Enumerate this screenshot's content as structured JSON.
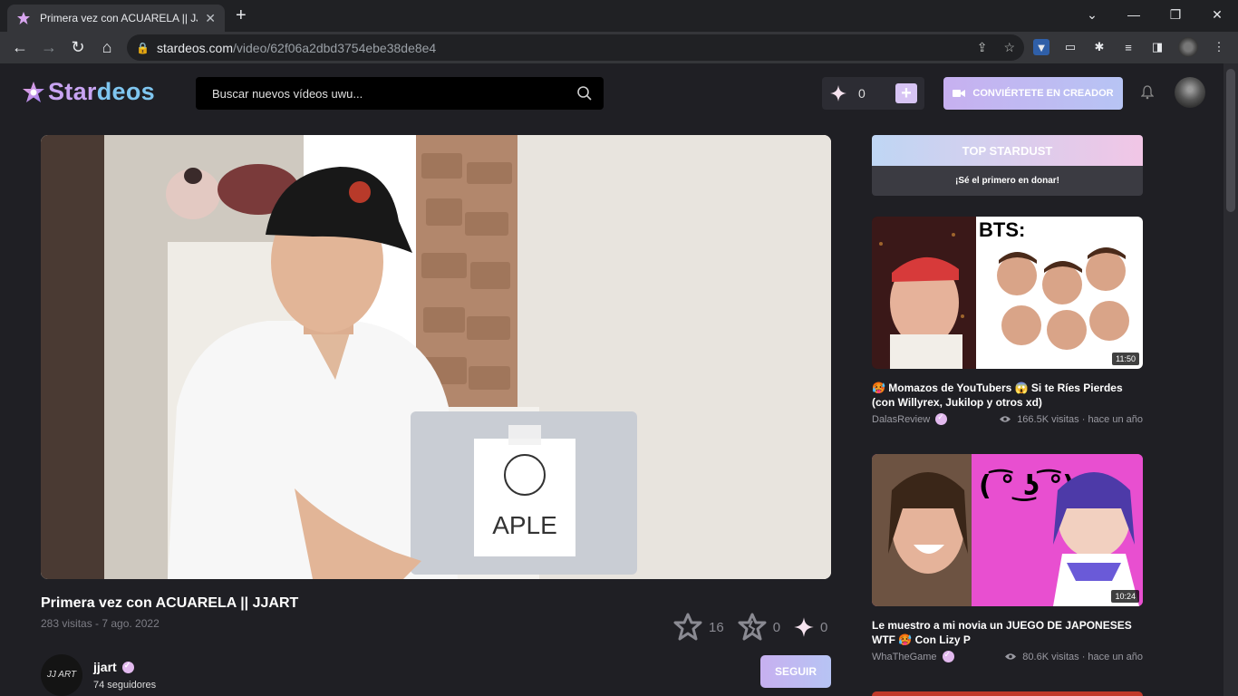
{
  "browser": {
    "tab_title": "Primera vez con ACUARELA || JJA",
    "url_host": "stardeos.com",
    "url_path": "/video/62f06a2dbd3754ebe38de8e4"
  },
  "header": {
    "logo_part1": "Star",
    "logo_part2": "deos",
    "search_placeholder": "Buscar nuevos vídeos uwu...",
    "stardust_balance": "0",
    "creator_button": "CONVIÉRTETE EN CREADOR"
  },
  "video": {
    "title": "Primera vez con ACUARELA || JJART",
    "meta": "283 visitas - 7 ago. 2022",
    "likes": "16",
    "dislikes": "0",
    "stardust": "0",
    "channel_initials": "JJ ART",
    "channel_name": "jjart",
    "followers": "74 seguidores",
    "follow_button": "SEGUIR",
    "laptop_sign": "APLE"
  },
  "sidebar": {
    "top_stardust_title": "TOP STARDUST",
    "top_stardust_empty": "¡Sé el primero en donar!",
    "cards": [
      {
        "title": "🥵 Momazos de YouTubers 😱 Si te Ríes Pierdes (con Willyrex, Jukilop y otros xd)",
        "channel": "DalasReview",
        "stats": "166.5K visitas · hace un año",
        "duration": "11:50",
        "overlay_text": "BTS:"
      },
      {
        "title": "Le muestro a mi novia un JUEGO DE JAPONESES WTF 🥵 Con Lizy P",
        "channel": "WhaTheGame",
        "stats": "80.6K visitas · hace un año",
        "duration": "10:24",
        "overlay_text": "( ͡° ͜ʖ ͡°)"
      }
    ]
  },
  "colors": {
    "accent_gradient_start": "#c7b0f0",
    "accent_gradient_end": "#b7c4f4",
    "background": "#1f1f24"
  }
}
